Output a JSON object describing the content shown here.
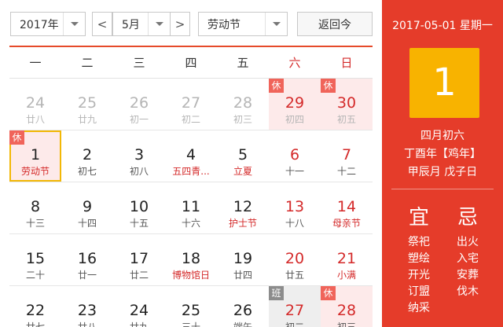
{
  "controls": {
    "year": "2017年",
    "prev": "<",
    "month": "5月",
    "next": ">",
    "holiday": "劳动节",
    "today_button": "返回今"
  },
  "weekdays": [
    "一",
    "二",
    "三",
    "四",
    "五",
    "六",
    "日"
  ],
  "weeks": [
    [
      {
        "d": "24",
        "l": "廿八",
        "other": true
      },
      {
        "d": "25",
        "l": "廿九",
        "other": true
      },
      {
        "d": "26",
        "l": "初一",
        "other": true
      },
      {
        "d": "27",
        "l": "初二",
        "other": true
      },
      {
        "d": "28",
        "l": "初三",
        "other": true
      },
      {
        "d": "29",
        "l": "初四",
        "other": true,
        "wkend": true,
        "holiday": true,
        "badge": "休"
      },
      {
        "d": "30",
        "l": "初五",
        "other": true,
        "wkend": true,
        "holiday": true,
        "badge": "休"
      }
    ],
    [
      {
        "d": "1",
        "l": "劳动节",
        "fest": true,
        "holiday": true,
        "selected": true,
        "badge": "休"
      },
      {
        "d": "2",
        "l": "初七"
      },
      {
        "d": "3",
        "l": "初八"
      },
      {
        "d": "4",
        "l": "五四青...",
        "fest": true
      },
      {
        "d": "5",
        "l": "立夏",
        "fest": true
      },
      {
        "d": "6",
        "l": "十一",
        "wkend": true
      },
      {
        "d": "7",
        "l": "十二",
        "wkend": true
      }
    ],
    [
      {
        "d": "8",
        "l": "十三"
      },
      {
        "d": "9",
        "l": "十四"
      },
      {
        "d": "10",
        "l": "十五"
      },
      {
        "d": "11",
        "l": "十六"
      },
      {
        "d": "12",
        "l": "护士节",
        "fest": true
      },
      {
        "d": "13",
        "l": "十八",
        "wkend": true
      },
      {
        "d": "14",
        "l": "母亲节",
        "wkend": true,
        "fest": true
      }
    ],
    [
      {
        "d": "15",
        "l": "二十"
      },
      {
        "d": "16",
        "l": "廿一"
      },
      {
        "d": "17",
        "l": "廿二"
      },
      {
        "d": "18",
        "l": "博物馆日",
        "fest": true
      },
      {
        "d": "19",
        "l": "廿四"
      },
      {
        "d": "20",
        "l": "廿五",
        "wkend": true
      },
      {
        "d": "21",
        "l": "小满",
        "wkend": true,
        "fest": true
      }
    ],
    [
      {
        "d": "22",
        "l": "廿七"
      },
      {
        "d": "23",
        "l": "廿八"
      },
      {
        "d": "24",
        "l": "廿九"
      },
      {
        "d": "25",
        "l": "三十"
      },
      {
        "d": "26",
        "l": "端午"
      },
      {
        "d": "27",
        "l": "初二",
        "wkend": true,
        "work": true,
        "badge": "班"
      },
      {
        "d": "28",
        "l": "初三",
        "wkend": true,
        "holiday": true,
        "badge": "休"
      }
    ]
  ],
  "detail": {
    "date": "2017-05-01 星期一",
    "day": "1",
    "lunar_date": "四月初六",
    "ganzhi_year": "丁酉年【鸡年】",
    "ganzhi_month_day": "甲辰月 戊子日",
    "yi_title": "宜",
    "ji_title": "忌",
    "yi": [
      "祭祀",
      "塑绘",
      "开光",
      "订盟",
      "纳采"
    ],
    "ji": [
      "出火",
      "入宅",
      "安葬",
      "伐木"
    ]
  },
  "colors": {
    "accent": "#e53c2a",
    "big_day_bg": "#f8b300",
    "holiday_bg": "#fdeaea",
    "weekend_text": "#d42a2a",
    "selected_border": "#f2b806"
  }
}
